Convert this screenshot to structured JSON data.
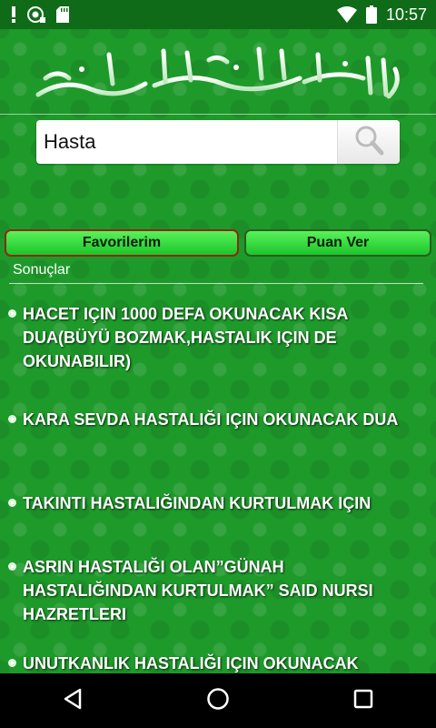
{
  "status_bar": {
    "time": "10:57",
    "icons": [
      "exclamation-icon",
      "camera-notification-icon",
      "sd-card-icon",
      "wifi-icon",
      "battery-icon"
    ]
  },
  "header": {
    "calligraphy_icon": "basmala-calligraphy-icon"
  },
  "search": {
    "value": "Hasta",
    "button_icon": "search-icon"
  },
  "buttons": {
    "favorites_label": "Favorilerim",
    "rate_label": "Puan Ver"
  },
  "section": {
    "label": "Sonuçlar"
  },
  "results": [
    {
      "title": "HACET IÇIN 1000 DEFA OKUNACAK KISA DUA(BÜYÜ BOZMAK,HASTALIK IÇIN DE OKUNABILIR)"
    },
    {
      "title": "KARA SEVDA HASTALIĞI  IÇIN OKUNACAK DUA"
    },
    {
      "title": "TAKINTI HASTALIĞINDAN KURTULMAK IÇIN"
    },
    {
      "title": "ASRIN HASTALIĞI OLAN”GÜNAH HASTALIĞINDAN KURTULMAK” SAID NURSI HAZRETLERI"
    },
    {
      "title": "UNUTKANLIK HASTALIĞI IÇIN OKUNACAK"
    }
  ],
  "nav": {
    "icons": [
      "back-icon",
      "home-icon",
      "recents-icon"
    ]
  },
  "colors": {
    "status_bar": "#0f6b17",
    "background_green": "#1e9a2b",
    "button_green": "#2ed43a",
    "text_white": "#ffffff"
  }
}
